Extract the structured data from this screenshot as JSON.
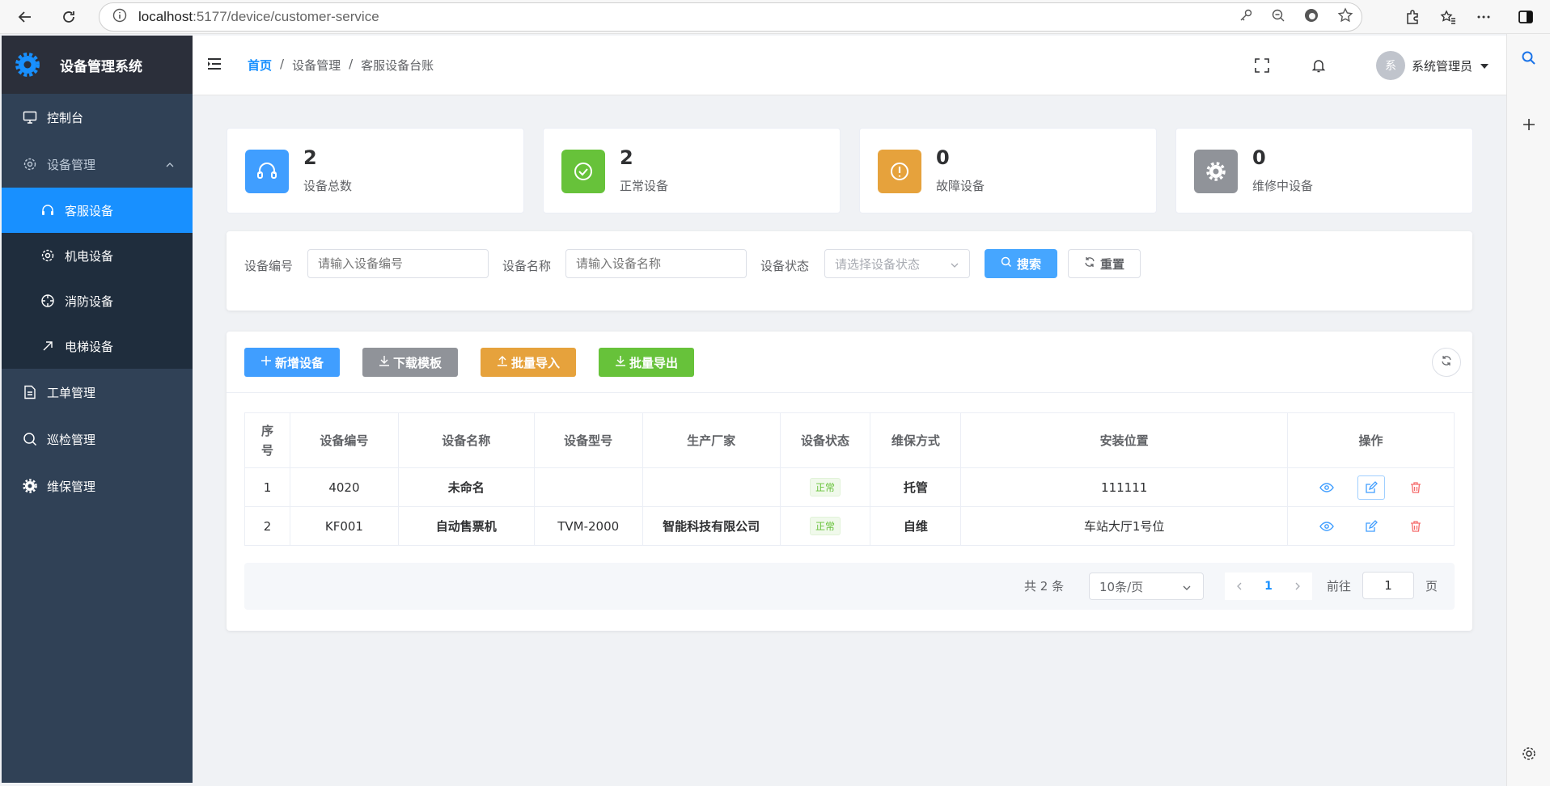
{
  "browser": {
    "url_host": "localhost",
    "url_path": ":5177/device/customer-service"
  },
  "app": {
    "title": "设备管理系统",
    "colors": {
      "sidebar": "#304156",
      "active": "#1890ff",
      "primary": "#46a6ff",
      "success": "#67c23a",
      "warning": "#e6a23c",
      "info": "#909399"
    }
  },
  "sidebar": {
    "items": [
      {
        "label": "控制台",
        "icon": "monitor-icon"
      },
      {
        "label": "设备管理",
        "icon": "gear-icon"
      },
      {
        "label": "工单管理",
        "icon": "document-icon"
      },
      {
        "label": "巡检管理",
        "icon": "search-icon"
      },
      {
        "label": "维保管理",
        "icon": "settings-icon"
      }
    ],
    "subitems": [
      {
        "label": "客服设备",
        "icon": "headset-icon"
      },
      {
        "label": "机电设备",
        "icon": "gear-icon"
      },
      {
        "label": "消防设备",
        "icon": "compass-icon"
      },
      {
        "label": "电梯设备",
        "icon": "arrow-up-right-icon"
      }
    ]
  },
  "header": {
    "breadcrumb": [
      "首页",
      "设备管理",
      "客服设备台账"
    ],
    "user": {
      "avatar_text": "系",
      "name": "系统管理员"
    }
  },
  "stats": [
    {
      "value": "2",
      "label": "设备总数",
      "color": "#409eff",
      "icon": "headset-icon"
    },
    {
      "value": "2",
      "label": "正常设备",
      "color": "#67c23a",
      "icon": "check-circle-icon"
    },
    {
      "value": "0",
      "label": "故障设备",
      "color": "#e6a23c",
      "icon": "warning-icon"
    },
    {
      "value": "0",
      "label": "维修中设备",
      "color": "#909399",
      "icon": "gear-icon"
    }
  ],
  "search": {
    "code_label": "设备编号",
    "code_placeholder": "请输入设备编号",
    "name_label": "设备名称",
    "name_placeholder": "请输入设备名称",
    "status_label": "设备状态",
    "status_placeholder": "请选择设备状态",
    "search_btn": "搜索",
    "reset_btn": "重置"
  },
  "toolbar": {
    "add": "新增设备",
    "download": "下载模板",
    "import": "批量导入",
    "export": "批量导出"
  },
  "table": {
    "headers": [
      "序\n号",
      "设备编号",
      "设备名称",
      "设备型号",
      "生产厂家",
      "设备状态",
      "维保方式",
      "安装位置",
      "操作"
    ],
    "rows": [
      {
        "idx": "1",
        "code": "4020",
        "name": "未命名",
        "model": "",
        "maker": "",
        "status": "正常",
        "maint": "托管",
        "location": "111111"
      },
      {
        "idx": "2",
        "code": "KF001",
        "name": "自动售票机",
        "model": "TVM-2000",
        "maker": "智能科技有限公司",
        "status": "正常",
        "maint": "自维",
        "location": "车站大厅1号位"
      }
    ]
  },
  "pagination": {
    "total": "共 2 条",
    "page_size": "10条/页",
    "current": "1",
    "goto_label": "前往",
    "goto_value": "1",
    "page_suffix": "页"
  }
}
